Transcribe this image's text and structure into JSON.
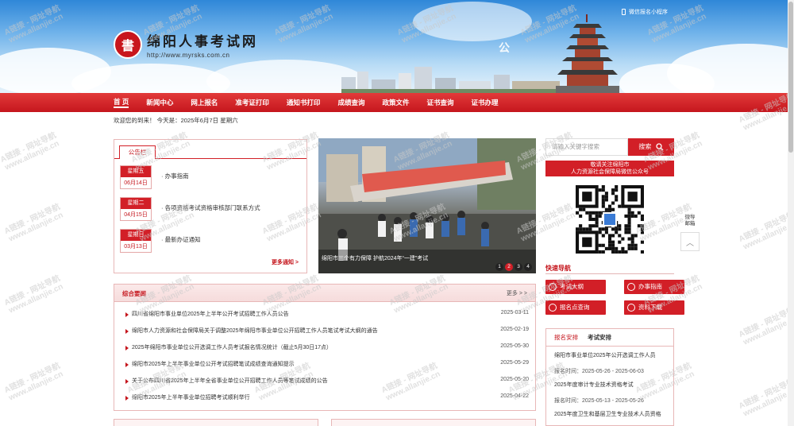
{
  "header": {
    "logo_char": "書",
    "site_title": "绵阳人事考试网",
    "site_url": "http://www.myrsks.com.cn",
    "wechat_link": "微信报名小程序",
    "public_mark": "公"
  },
  "nav": {
    "items": [
      "首 页",
      "新闻中心",
      "网上报名",
      "准考证打印",
      "通知书打印",
      "成绩查询",
      "政策文件",
      "证书查询",
      "证书办理"
    ]
  },
  "welcome": "欢迎您的到来！  今天是：2025年6月7日 星期六",
  "notice": {
    "tab": "公告栏",
    "items": [
      {
        "week": "星期五",
        "date": "06月14日",
        "title": "· 办事指南"
      },
      {
        "week": "星期二",
        "date": "04月15日",
        "title": "· 各项资格考试资格审核部门联系方式"
      },
      {
        "week": "星期日",
        "date": "03月13日",
        "title": "· 最新办证通知"
      }
    ],
    "more": "更多通知 >"
  },
  "photo": {
    "caption": "绵阳市三个有力保障 护航2024年“一建”考试",
    "dots": [
      "1",
      "2",
      "3",
      "4"
    ],
    "active_dot": 1
  },
  "search": {
    "placeholder": "请输入关键字搜索",
    "button": "搜索"
  },
  "follow": {
    "line1": "敬请关注绵阳市",
    "line2": "人力资源社会保障局微信公众号"
  },
  "side_tools": {
    "label": "微导\n邮箱",
    "up": "︿"
  },
  "quick": {
    "title": "快速导航",
    "buttons": [
      "考试大纲",
      "办事指南",
      "报名点查询",
      "资料下载"
    ]
  },
  "exam_box": {
    "tab1": "报名安排",
    "tab2": "考试安排",
    "items": [
      {
        "title": "绵阳市事业单位2025年公开选调工作人员",
        "period": "报名时间：2025-05-26 - 2025-06-03"
      },
      {
        "title": "2025年度审计专业技术资格考试",
        "period": "报名时间：2025-05-13 - 2025-05-26"
      },
      {
        "title": "2025年度卫生和基层卫生专业技术人员资格",
        "period": ""
      }
    ]
  },
  "news": {
    "title": "综合要闻",
    "more": "更多 > >",
    "rows": [
      {
        "title": "四川省绵阳市事业单位2025年上半年公开考试招聘工作人员公告",
        "date": "2025-03-11"
      },
      {
        "title": "绵阳市人力资源和社会保障局关于调整2025年绵阳市事业单位公开招聘工作人员笔试考试大纲的通告",
        "date": "2025-02-19"
      },
      {
        "title": "2025年绵阳市事业单位公开选调工作人员考试报名情况统计（截止5月30日17点）",
        "date": "2025-05-30"
      },
      {
        "title": "绵阳市2025年上半年事业单位公开考试招聘笔试成绩查询通知提示",
        "date": "2025-05-29"
      },
      {
        "title": "关于公布四川省2025年上半年全省事业单位公开招聘工作人员等笔试成绩的公告",
        "date": "2025-05-20"
      },
      {
        "title": "绵阳市2025年上半年事业单位招聘考试顺利举行",
        "date": "2025-04-22"
      }
    ]
  },
  "watermark": {
    "line1": "A链接 - 网址导航",
    "line2": "www.allanjie.cn"
  },
  "colors": {
    "brand_red": "#d21f27",
    "nav_red": "#c5161d"
  }
}
